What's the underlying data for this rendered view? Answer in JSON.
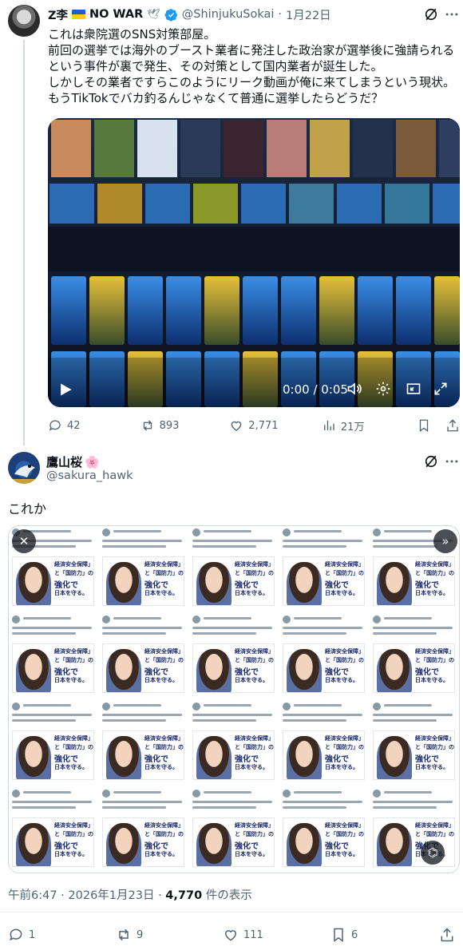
{
  "tweet1": {
    "display_name": "Z李",
    "name_suffix": "NO WAR",
    "dove_symbol": "🕊",
    "handle": "@ShinjukuSokai",
    "date": "1月22日",
    "body_lines": [
      "これは衆院選のSNS対策部屋。",
      "前回の選挙では海外のブースト業者に発注した政治家が選挙後に強請られる",
      "という事件が裏で発生、その対策として国内業者が誕生した。",
      "しかしその業者ですらこのようにリーク動画が俺に来てしまうという現状。",
      "もうTikTokでバカ釣るんじゃなくて普通に選挙したらどうだ？"
    ],
    "video_time": "0:00 / 0:05",
    "replies": "42",
    "reposts": "893",
    "likes": "2,771",
    "views": "21万"
  },
  "tweet2": {
    "display_name": "鷹山桜",
    "name_emoji": "🌸",
    "handle": "@sakura_hawk",
    "text": "これか",
    "poster_lines": [
      "経済安全保障」",
      "と「国防力」の",
      "強化で",
      "日本を守る。"
    ],
    "timestamp": "午前6:47 · 2026年1月23日 · ",
    "views_count": "4,770",
    "views_label": " 件の表示",
    "replies": "1",
    "reposts": "9",
    "likes": "111",
    "bookmarks": "6"
  },
  "icons": {
    "verified": "verified-badge-icon",
    "grok": "grok-icon",
    "more": "more-icon",
    "reply": "reply-icon",
    "repost": "repost-icon",
    "like": "like-icon",
    "views": "views-icon",
    "bookmark": "bookmark-icon",
    "share": "share-icon"
  },
  "colors": {
    "text": "#0f1419",
    "secondary": "#536471",
    "verified": "#1d9bf0",
    "thread_line": "#cfd9de"
  }
}
